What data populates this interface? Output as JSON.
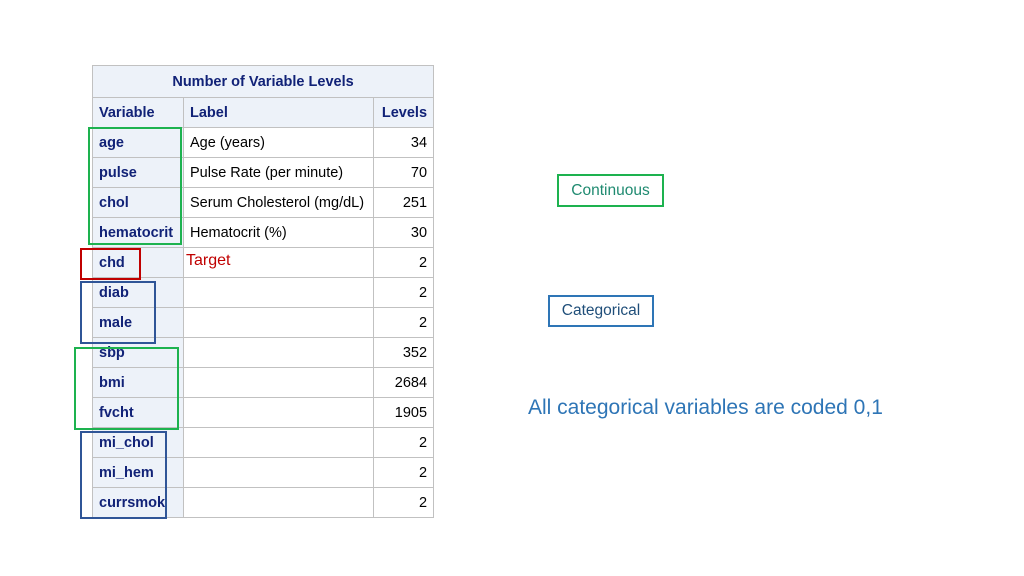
{
  "table": {
    "title": "Number of Variable Levels",
    "headers": {
      "variable": "Variable",
      "label": "Label",
      "levels": "Levels"
    },
    "rows": [
      {
        "variable": "age",
        "label": "Age (years)",
        "levels": "34"
      },
      {
        "variable": "pulse",
        "label": "Pulse Rate (per minute)",
        "levels": "70"
      },
      {
        "variable": "chol",
        "label": "Serum Cholesterol (mg/dL)",
        "levels": "251"
      },
      {
        "variable": "hematocrit",
        "label": "Hematocrit (%)",
        "levels": "30"
      },
      {
        "variable": "chd",
        "label": "",
        "levels": "2"
      },
      {
        "variable": "diab",
        "label": "",
        "levels": "2"
      },
      {
        "variable": "male",
        "label": "",
        "levels": "2"
      },
      {
        "variable": "sbp",
        "label": "",
        "levels": "352"
      },
      {
        "variable": "bmi",
        "label": "",
        "levels": "2684"
      },
      {
        "variable": "fvcht",
        "label": "",
        "levels": "1905"
      },
      {
        "variable": "mi_chol",
        "label": "",
        "levels": "2"
      },
      {
        "variable": "mi_hem",
        "label": "",
        "levels": "2"
      },
      {
        "variable": "currsmok",
        "label": "",
        "levels": "2"
      }
    ]
  },
  "annotations": {
    "target": "Target",
    "continuous": "Continuous",
    "categorical": "Categorical",
    "note": "All categorical variables are coded 0,1"
  },
  "colors": {
    "continuous": "#1db24f",
    "categorical": "#2e75b6",
    "target": "#c00000",
    "header_bg": "#edf2f9",
    "header_text": "#112277"
  }
}
